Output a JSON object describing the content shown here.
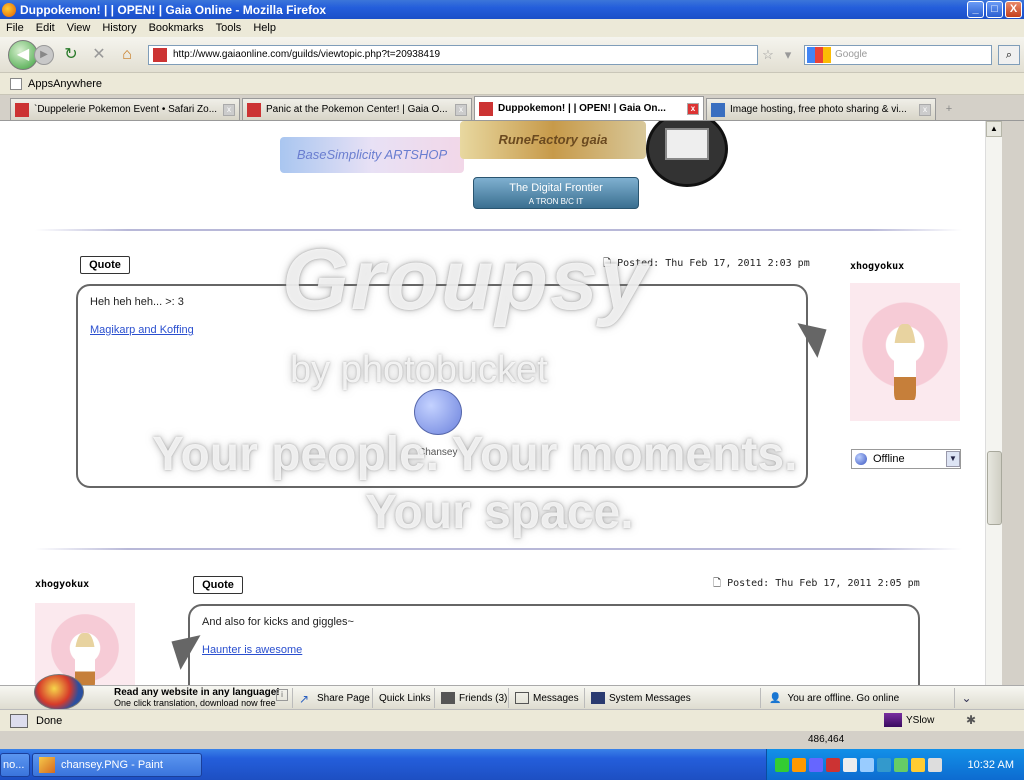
{
  "window": {
    "title": "Duppokemon! | | OPEN! | Gaia Online - Mozilla Firefox",
    "buttons": {
      "minimize": "_",
      "maximize": "□",
      "close": "X"
    }
  },
  "menu": [
    "File",
    "Edit",
    "View",
    "History",
    "Bookmarks",
    "Tools",
    "Help"
  ],
  "nav": {
    "url": "http://www.gaiaonline.com/guilds/viewtopic.php?t=20938419",
    "search_placeholder": "Google"
  },
  "bookmarks": {
    "item": "AppsAnywhere"
  },
  "tabs": [
    {
      "label": "`Duppelerie Pokemon Event • Safari Zo..."
    },
    {
      "label": "Panic at the Pokemon Center! | Gaia O..."
    },
    {
      "label": "Duppokemon! | | OPEN! | Gaia On..."
    },
    {
      "label": "Image hosting, free photo sharing & vi..."
    }
  ],
  "banners": {
    "b1": "BaseSimplicity ARTSHOP",
    "b2": "RuneFactory gaia",
    "b3_line1": "The Digital Frontier",
    "b3_line2": "A TRON B/C IT"
  },
  "posts": [
    {
      "quote": "Quote",
      "posted": "Posted: Thu Feb 17, 2011 2:03 pm",
      "username": "xhogyokux",
      "message": "Heh heh heh... >: 3",
      "link": "Magikarp and Koffing",
      "status": "Offline",
      "image_label": "Chansey"
    },
    {
      "quote": "Quote",
      "posted": "Posted: Thu Feb 17, 2011 2:05 pm",
      "username": "xhogyokux",
      "message": "And also for kicks and giggles~",
      "link": "Haunter is awesome"
    }
  ],
  "watermark": {
    "brand": "Groupsy",
    "by": "by photobucket",
    "tag1": "Your people. Your moments.",
    "tag2": "Your space."
  },
  "toolbar": {
    "translate_title": "Read any website in any language!",
    "translate_sub": "One click translation, download now free",
    "share": "Share Page",
    "quick_links": "Quick Links",
    "friends": "Friends (3)",
    "messages": "Messages",
    "system_messages": "System Messages",
    "offline": "You are offline. Go online"
  },
  "status": {
    "text": "Done",
    "yslow": "YSlow",
    "coords": "486,464"
  },
  "taskbar": {
    "item0": "no...",
    "item1": "chansey.PNG - Paint",
    "clock": "10:32 AM"
  },
  "colors": {
    "link": "#2a4fcf",
    "titlebar": "#245edb"
  }
}
